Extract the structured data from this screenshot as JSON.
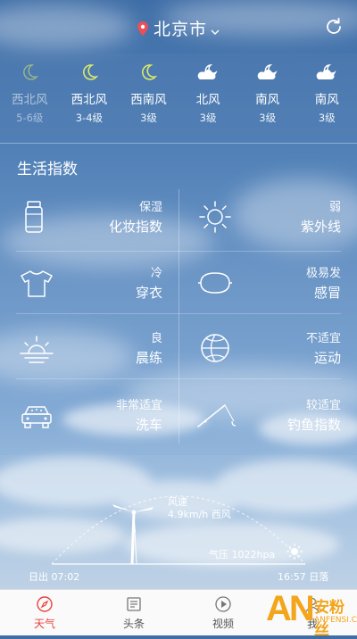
{
  "header": {
    "city": "北京市",
    "icons": [
      "location-pin-icon",
      "chevron-down-icon",
      "refresh-icon"
    ]
  },
  "forecast": [
    {
      "icon": "moon-icon",
      "wind": "西北风",
      "level": "5-6级",
      "past": true
    },
    {
      "icon": "moon-icon",
      "wind": "西北风",
      "level": "3-4级",
      "past": false
    },
    {
      "icon": "moon-icon",
      "wind": "西南风",
      "level": "3级",
      "past": false
    },
    {
      "icon": "cloudy-night-icon",
      "wind": "北风",
      "level": "3级",
      "past": false
    },
    {
      "icon": "cloudy-night-icon",
      "wind": "南风",
      "level": "3级",
      "past": false
    },
    {
      "icon": "cloudy-night-icon",
      "wind": "南风",
      "level": "3级",
      "past": false
    }
  ],
  "life_index": {
    "title": "生活指数",
    "items": [
      {
        "icon": "lotion-bottle-icon",
        "sub": "保湿",
        "main": "化妆指数"
      },
      {
        "icon": "sun-icon",
        "sub": "弱",
        "main": "紫外线"
      },
      {
        "icon": "tshirt-icon",
        "sub": "冷",
        "main": "穿衣"
      },
      {
        "icon": "pill-capsule-icon",
        "sub": "极易发",
        "main": "感冒"
      },
      {
        "icon": "sunrise-icon",
        "sub": "良",
        "main": "晨练"
      },
      {
        "icon": "ball-icon",
        "sub": "不适宜",
        "main": "运动"
      },
      {
        "icon": "car-wash-icon",
        "sub": "非常适宜",
        "main": "洗车"
      },
      {
        "icon": "fishing-rod-icon",
        "sub": "较适宜",
        "main": "钓鱼指数"
      }
    ]
  },
  "sun_wind": {
    "wind_title": "风速",
    "wind_value": "4.9km/h 西风",
    "pressure": "气压 1022hpa",
    "sunrise": "日出 07:02",
    "sunset": "16:57 日落"
  },
  "tabs": [
    {
      "icon": "compass-icon",
      "label": "天气",
      "active": true
    },
    {
      "icon": "news-icon",
      "label": "头条",
      "active": false
    },
    {
      "icon": "play-icon",
      "label": "视频",
      "active": false
    },
    {
      "icon": "profile-icon",
      "label": "我",
      "active": false
    }
  ],
  "watermark": {
    "logo": "AN",
    "cn": "安粉丝",
    "en": "ANFENSI.COM"
  },
  "colors": {
    "accent": "#e8433a",
    "moon": "#d8e86a",
    "watermark": "#f3a51b"
  }
}
